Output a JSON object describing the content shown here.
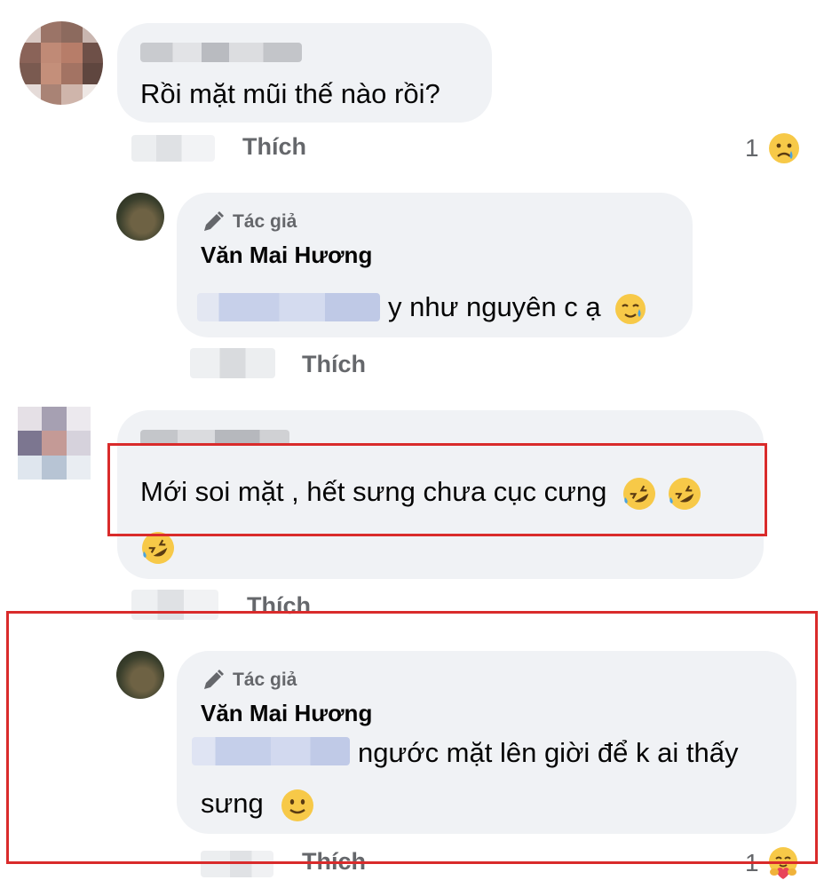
{
  "comments": [
    {
      "text": "Rồi mặt mũi thế nào rồi?",
      "like_label": "Thích",
      "reaction_count": "1",
      "reaction_icon": "sad-tear-icon"
    },
    {
      "badge": "Tác giả",
      "author": "Văn Mai Hương",
      "text": "y như nguyên c ạ",
      "like_label": "Thích",
      "emoji_icon": "smile-tear-icon"
    },
    {
      "text": "Mới soi mặt , hết sưng chưa cục cưng",
      "like_label": "Thích",
      "emoji_icon": "rolling-laughing-icon"
    },
    {
      "badge": "Tác giả",
      "author": "Văn Mai Hương",
      "text_line1": "ngước mặt lên giời để k ai thấy",
      "text_line2": "sưng",
      "like_label": "Thích",
      "reaction_count": "1",
      "reaction_icon": "hug-care-icon",
      "emoji_icon": "slight-smile-icon"
    }
  ],
  "colors": {
    "bubble": "#f0f2f5",
    "highlight": "#d92b2b",
    "secondary_text": "#65676b"
  }
}
